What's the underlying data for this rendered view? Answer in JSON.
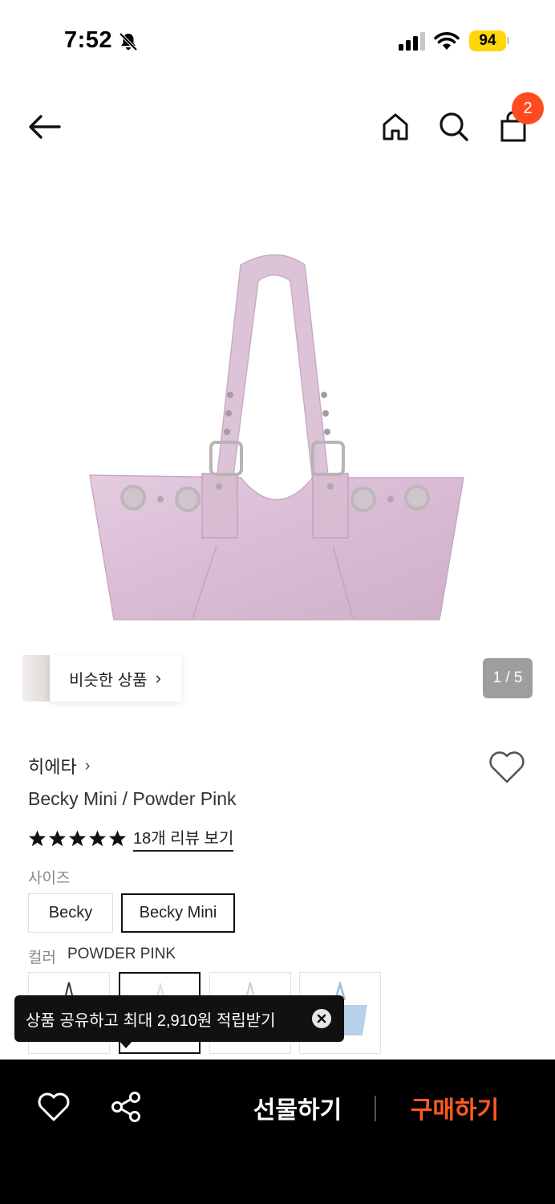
{
  "status_bar": {
    "time": "7:52",
    "battery": "94"
  },
  "nav": {
    "cart_count": "2"
  },
  "gallery": {
    "similar_label": "비슷한 상품",
    "page_indicator": "1 / 5"
  },
  "product": {
    "brand": "히에타",
    "name": "Becky Mini / Powder Pink",
    "rating_stars": 5,
    "review_link": "18개 리뷰 보기"
  },
  "options": {
    "size_label": "사이즈",
    "sizes": [
      "Becky",
      "Becky Mini"
    ],
    "selected_size": "Becky Mini",
    "color_label": "컬러",
    "selected_color": "POWDER PINK"
  },
  "toast": {
    "text": "상품 공유하고 최대 2,910원 적립받기"
  },
  "bottom_bar": {
    "gift_label": "선물하기",
    "buy_label": "구매하기",
    "buy_color": "#ff5a1f"
  },
  "colors": {
    "accent": "#ff4b1f",
    "bag_pink": "#dcc0d6"
  }
}
